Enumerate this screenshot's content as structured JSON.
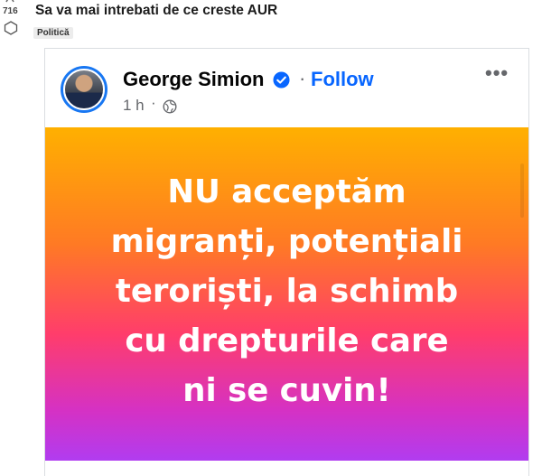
{
  "post": {
    "score": "716",
    "title": "Sa va mai intrebati de ce creste AUR",
    "flair": "Politică"
  },
  "embed": {
    "author": "George Simion",
    "separator": "·",
    "follow_label": "Follow",
    "more_label": "•••",
    "timestamp": "1 h",
    "meta_dot": "·",
    "banner_lines": [
      "NU acceptăm",
      "migranți, potențiali",
      "teroriști, la schimb",
      "cu drepturile care",
      "ni se cuvin!"
    ]
  },
  "colors": {
    "follow": "#0866ff",
    "verified": "#0866ff",
    "banner_top": "#ffb000",
    "banner_bottom": "#b13cf0"
  },
  "icons": {
    "upvote": "arrow-up-icon",
    "downvote": "hexagon-downvote-icon",
    "verified": "verified-badge-icon",
    "privacy": "globe-icon",
    "more": "more-horizontal-icon"
  }
}
